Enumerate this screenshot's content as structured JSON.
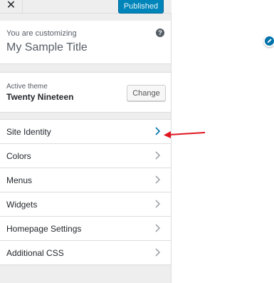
{
  "header": {
    "close_glyph": "✕",
    "publish_label": "Published"
  },
  "info": {
    "label": "You are customizing",
    "site_title": "My Sample Title",
    "help_glyph": "?"
  },
  "theme": {
    "label": "Active theme",
    "name": "Twenty Nineteen",
    "change_label": "Change"
  },
  "menu": {
    "items": [
      {
        "label": "Site Identity",
        "icon": "chevron-right-icon"
      },
      {
        "label": "Colors",
        "icon": "chevron-right-icon"
      },
      {
        "label": "Menus",
        "icon": "chevron-right-icon"
      },
      {
        "label": "Widgets",
        "icon": "chevron-right-icon"
      },
      {
        "label": "Homepage Settings",
        "icon": "chevron-right-icon"
      },
      {
        "label": "Additional CSS",
        "icon": "chevron-right-icon"
      }
    ]
  },
  "preview": {
    "edit_shortcut_icon": "pencil-icon"
  },
  "colors": {
    "accent": "#0085ba",
    "annotation_arrow": "#e0151f"
  }
}
